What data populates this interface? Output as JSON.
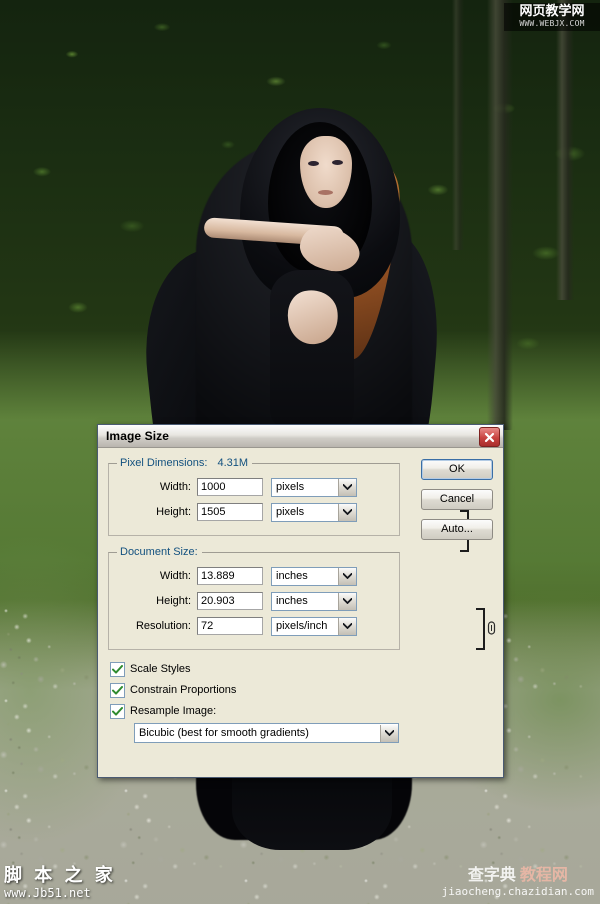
{
  "photo": {
    "description": "woman-in-black-hooded-cloak-in-forest",
    "colors": {
      "forest_dark": "#14240f",
      "grass": "#688e42",
      "gravel_path": "#b0b0a4",
      "cloak_black": "#0a0b0e",
      "hair_red": "#b2652b",
      "skin": "#f0dbcb"
    }
  },
  "dialog": {
    "title": "Image Size",
    "close_icon": "close-icon",
    "pixel_dimensions": {
      "legend": "Pixel Dimensions:",
      "size": "4.31M",
      "rows": [
        {
          "label": "Width:",
          "value": "1000",
          "unit": "pixels"
        },
        {
          "label": "Height:",
          "value": "1505",
          "unit": "pixels"
        }
      ],
      "link_icon": "chain-link-icon"
    },
    "document_size": {
      "legend": "Document Size:",
      "rows": [
        {
          "label": "Width:",
          "value": "13.889",
          "unit": "inches"
        },
        {
          "label": "Height:",
          "value": "20.903",
          "unit": "inches"
        },
        {
          "label": "Resolution:",
          "value": "72",
          "unit": "pixels/inch"
        }
      ],
      "link_icon": "chain-link-icon"
    },
    "checkboxes": [
      {
        "label": "Scale Styles",
        "checked": true
      },
      {
        "label": "Constrain Proportions",
        "checked": true
      },
      {
        "label": "Resample Image:",
        "checked": true
      }
    ],
    "resample_method": "Bicubic (best for smooth gradients)",
    "buttons": [
      {
        "label": "OK",
        "default": true
      },
      {
        "label": "Cancel",
        "default": false
      },
      {
        "label": "Auto...",
        "default": false
      }
    ],
    "colors": {
      "face": "#ece9d8",
      "legend_blue": "#13517f",
      "field_border_blue": "#7f9db9",
      "check_green": "#2e8b2e",
      "close_red": "#c8423f",
      "default_btn_blue": "#3a6ea5"
    }
  },
  "watermarks": {
    "top_right": {
      "cn": "网页教学网",
      "en": "WWW.WEBJX.COM"
    },
    "bottom_left": {
      "cn": "脚 本 之 家",
      "en": "www.Jb51.net"
    },
    "bottom_right": {
      "cn1": "查字典",
      "cn2": "教程网",
      "en": "jiaocheng.chazidian.com"
    }
  }
}
